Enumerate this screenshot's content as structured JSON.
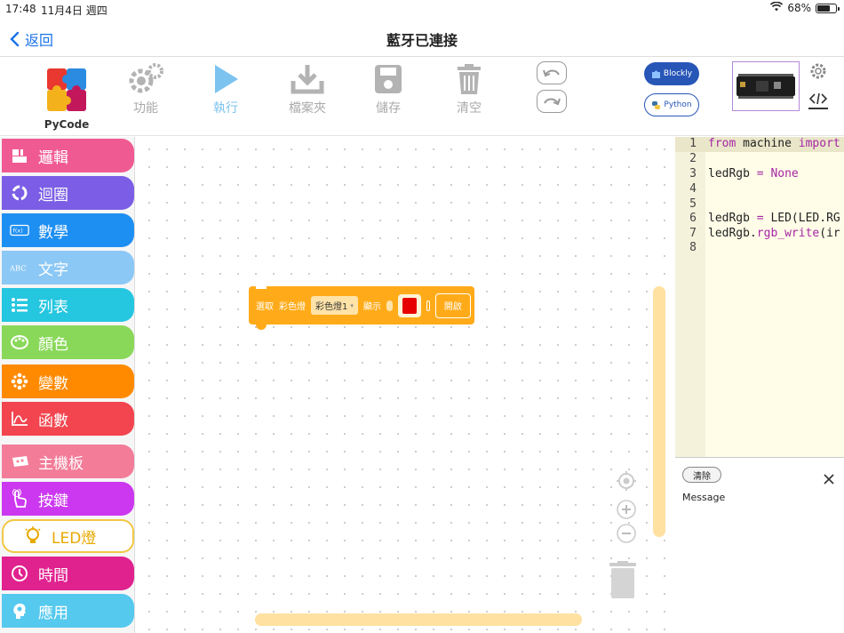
{
  "status": {
    "time": "17:48",
    "date": "11月4日 週四",
    "battery": "68%"
  },
  "nav": {
    "back_label": "返回",
    "title": "藍牙已連接"
  },
  "toolbar": {
    "brand": "PyCode",
    "function_label": "功能",
    "run_label": "執行",
    "file_label": "檔案夾",
    "save_label": "儲存",
    "clear_label": "清空",
    "blockly_label": "Blockly",
    "python_label": "Python"
  },
  "categories": [
    {
      "label": "邏輯",
      "color": "#f05a93"
    },
    {
      "label": "迴圈",
      "color": "#7b5ee5"
    },
    {
      "label": "數學",
      "color": "#1e8ff2"
    },
    {
      "label": "文字",
      "color": "#8cc8f5"
    },
    {
      "label": "列表",
      "color": "#25c6e0"
    },
    {
      "label": "顏色",
      "color": "#8ad85a"
    },
    {
      "label": "變數",
      "color": "#ff8a00"
    },
    {
      "label": "函數",
      "color": "#f2454f"
    },
    {
      "label": "主機板",
      "color": "#f37c98"
    },
    {
      "label": "按鍵",
      "color": "#cc38f0"
    },
    {
      "label": "LED燈",
      "color": "#f2c744"
    },
    {
      "label": "時間",
      "color": "#e0228f"
    },
    {
      "label": "應用",
      "color": "#55c9ee"
    }
  ],
  "block": {
    "select_label": "選取",
    "led_label": "彩色燈",
    "dropdown_value": "彩色燈1",
    "show_label": "顯示",
    "color_value": "#e60000",
    "toggle_label": "開啟"
  },
  "code": {
    "lines": [
      {
        "n": "1",
        "text": "from machine import"
      },
      {
        "n": "2",
        "text": ""
      },
      {
        "n": "3",
        "text": "ledRgb = None"
      },
      {
        "n": "4",
        "text": ""
      },
      {
        "n": "5",
        "text": ""
      },
      {
        "n": "6",
        "text": "ledRgb = LED(LED.RG"
      },
      {
        "n": "7",
        "text": "ledRgb.rgb_write(ir"
      },
      {
        "n": "8",
        "text": ""
      }
    ]
  },
  "message": {
    "clear_label": "清除",
    "label": "Message"
  }
}
